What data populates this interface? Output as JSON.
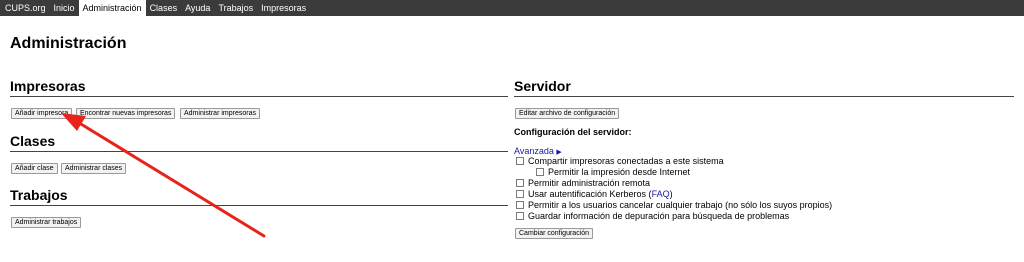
{
  "navbar": {
    "items": [
      {
        "label": "CUPS.org",
        "active": false
      },
      {
        "label": "Inicio",
        "active": false
      },
      {
        "label": "Administración",
        "active": true
      },
      {
        "label": "Clases",
        "active": false
      },
      {
        "label": "Ayuda",
        "active": false
      },
      {
        "label": "Trabajos",
        "active": false
      },
      {
        "label": "Impresoras",
        "active": false
      }
    ]
  },
  "page": {
    "title": "Administración"
  },
  "printers": {
    "heading": "Impresoras",
    "add_label": "Añadir impresora",
    "find_label": "Encontrar nuevas impresoras",
    "manage_label": "Administrar impresoras"
  },
  "classes": {
    "heading": "Clases",
    "add_label": "Añadir clase",
    "manage_label": "Administrar clases"
  },
  "jobs": {
    "heading": "Trabajos",
    "manage_label": "Administrar trabajos"
  },
  "server": {
    "heading": "Servidor",
    "edit_config_label": "Editar archivo de configuración",
    "config_title": "Configuración del servidor:",
    "advanced_label": "Avanzada",
    "advanced_icon": "triangle-right-icon",
    "options": [
      {
        "label": "Compartir impresoras conectadas a este sistema",
        "checked": false
      },
      {
        "label": "Permitir la impresión desde Internet",
        "checked": false
      },
      {
        "label": "Permitir administración remota",
        "checked": false
      },
      {
        "label_prefix": "Usar autentificación Kerberos (",
        "link": "FAQ",
        "label_suffix": ")",
        "checked": false
      },
      {
        "label": "Permitir a los usuarios cancelar cualquier trabajo (no sólo los suyos propios)",
        "checked": false
      },
      {
        "label": "Guardar información de depuración para búsqueda de problemas",
        "checked": false
      }
    ],
    "change_config_label": "Cambiar configuración"
  },
  "annotation": {
    "color": "#e8231a"
  }
}
